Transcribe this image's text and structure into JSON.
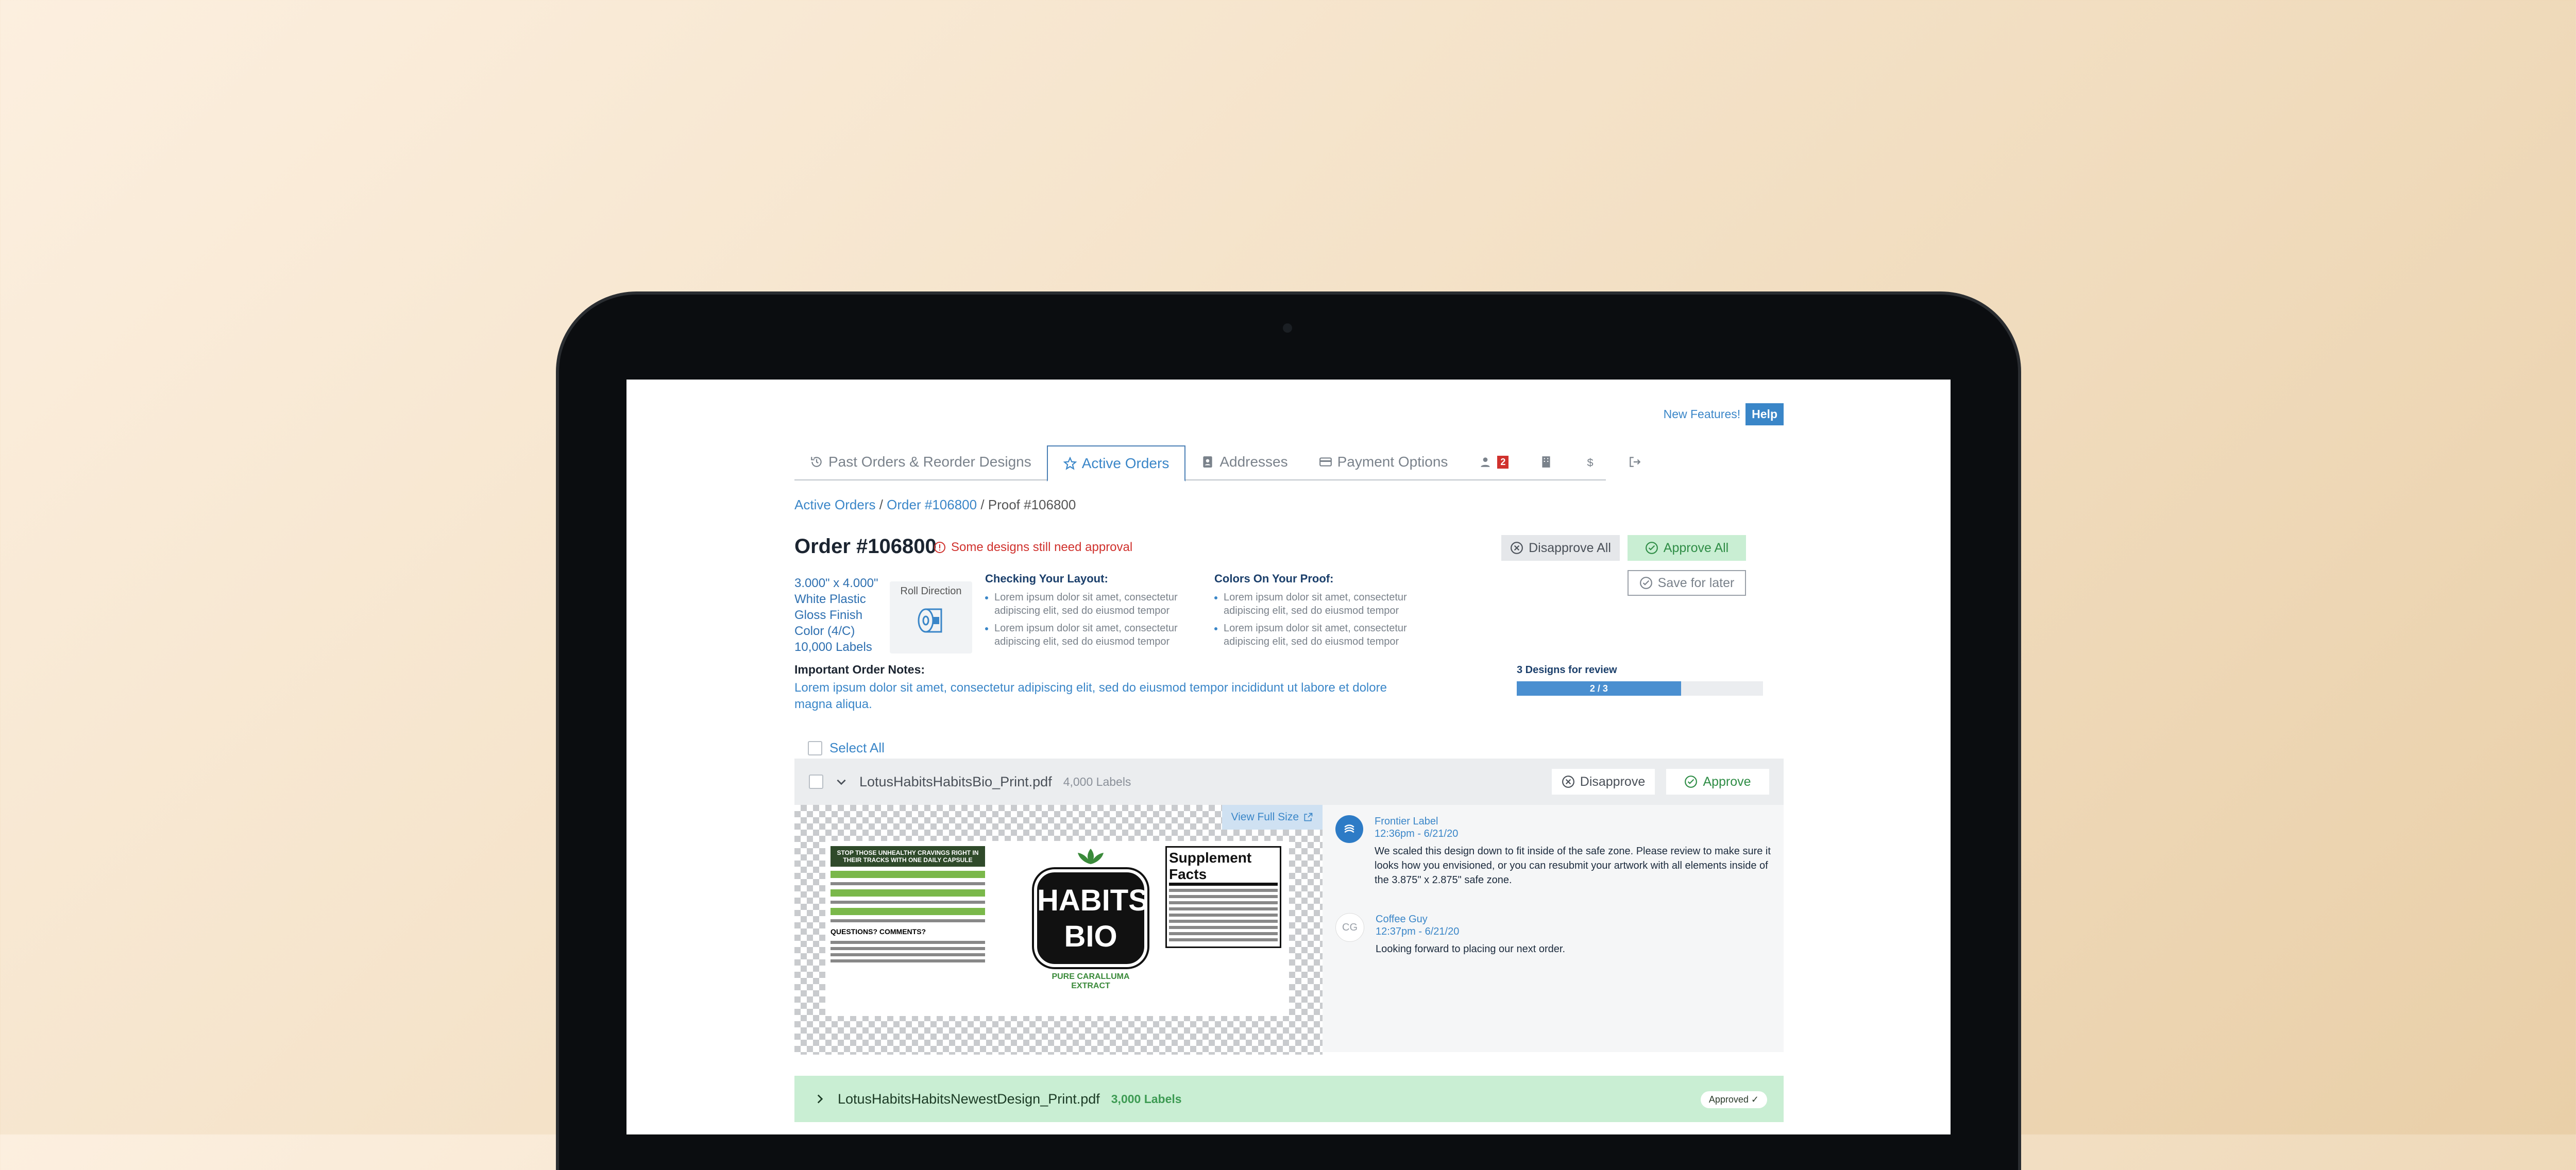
{
  "header": {
    "new_features": "New Features!",
    "help": "Help"
  },
  "tabs": [
    {
      "label": "Past Orders & Reorder Designs",
      "icon": "history-icon"
    },
    {
      "label": "Active Orders",
      "icon": "star-icon"
    },
    {
      "label": "Addresses",
      "icon": "address-book-icon"
    },
    {
      "label": "Payment Options",
      "icon": "credit-card-icon"
    }
  ],
  "user_badge": "2",
  "breadcrumb": {
    "active_orders": "Active Orders",
    "order": "Order #106800",
    "proof": "/ Proof #106800",
    "sep": " / "
  },
  "order": {
    "title": "Order #106800",
    "warning": "Some designs still need approval",
    "disapprove_all": "Disapprove All",
    "approve_all": "Approve All",
    "save_for_later": "Save for later",
    "specs": [
      "3.000\" x 4.000\"",
      "White Plastic",
      "Gloss Finish",
      "Color (4/C)",
      "10,000 Labels"
    ],
    "roll_direction": "Roll Direction",
    "checking_title": "Checking Your Layout:",
    "checking_items": [
      "Lorem ipsum dolor sit amet, consectetur adipiscing elit, sed do eiusmod tempor",
      "Lorem ipsum dolor sit amet, consectetur adipiscing elit, sed do eiusmod tempor"
    ],
    "colors_title": "Colors On Your Proof:",
    "colors_items": [
      "Lorem ipsum dolor sit amet, consectetur adipiscing elit, sed do eiusmod tempor",
      "Lorem ipsum dolor sit amet, consectetur adipiscing elit, sed do eiusmod tempor"
    ],
    "notes_title": "Important Order Notes:",
    "notes_text": "Lorem ipsum dolor sit amet, consectetur adipiscing elit, sed do eiusmod tempor incididunt ut labore et dolore magna aliqua.",
    "designs_label": "3 Designs for review",
    "progress_text": "2 / 3",
    "progress_fraction": 0.667
  },
  "select_all": "Select All",
  "designs": [
    {
      "filename": "LotusHabitsHabitsBio_Print.pdf",
      "count": "4,000 Labels",
      "disapprove": "Disapprove",
      "approve": "Approve",
      "view_full": "View Full Size",
      "label_brand": "HABITS BIO",
      "label_extract": "PURE CARALLUMA EXTRACT",
      "label_facts": "Supplement Facts",
      "label_tagline": "STOP THOSE UNHEALTHY CRAVINGS RIGHT IN THEIR TRACKS WITH ONE DAILY CAPSULE",
      "label_questions": "QUESTIONS? COMMENTS?",
      "comments": [
        {
          "initials": "",
          "author": "Frontier Label",
          "time": "12:36pm - 6/21/20",
          "text": "We scaled this design down to fit inside of the safe zone. Please review to make sure it looks how you envisioned, or you can resubmit your artwork with all elements inside of the 3.875\" x 2.875\" safe zone."
        },
        {
          "initials": "CG",
          "author": "Coffee Guy",
          "time": "12:37pm - 6/21/20",
          "text": "Looking forward to placing our next order."
        }
      ]
    },
    {
      "filename": "LotusHabitsHabitsNewestDesign_Print.pdf",
      "count": "3,000 Labels",
      "status": "Approved ✓"
    }
  ],
  "colors": {
    "accent": "#3a86c8",
    "approve_green": "#3d9b53",
    "warn_red": "#d0312d",
    "approved_row": "#c9eed3"
  }
}
